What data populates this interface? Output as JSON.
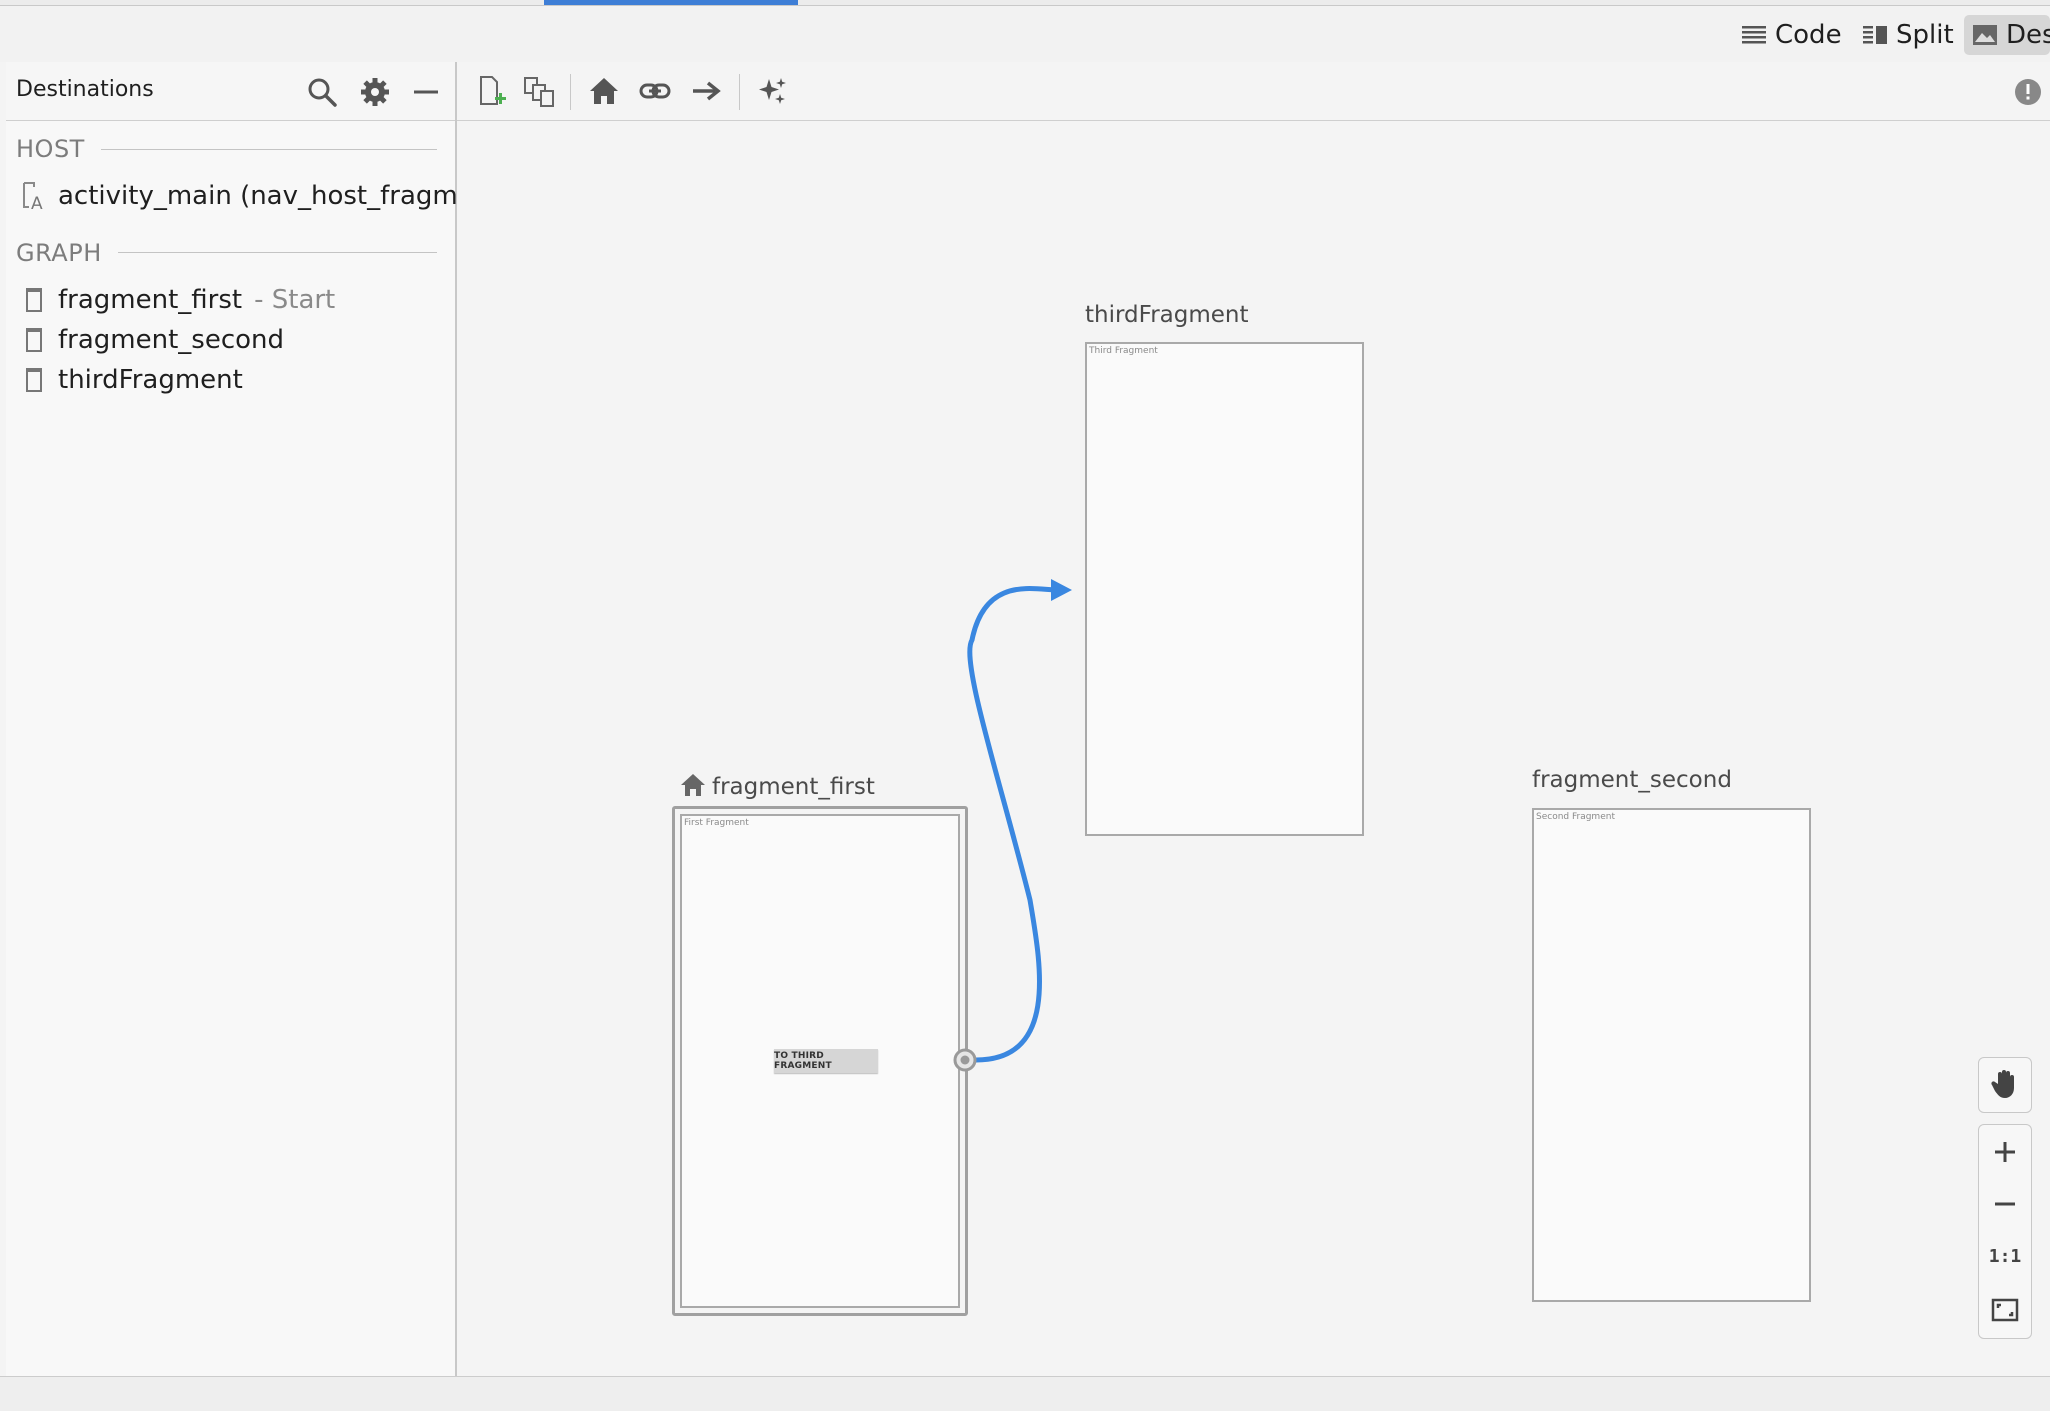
{
  "mode_bar": {
    "code_label": "Code",
    "split_label": "Split",
    "design_label": "Des"
  },
  "destinations_panel": {
    "title": "Destinations",
    "host_section": {
      "title": "HOST",
      "items": [
        {
          "label": "activity_main (nav_host_fragmen",
          "icon": "layout-activity-icon"
        }
      ]
    },
    "graph_section": {
      "title": "GRAPH",
      "items": [
        {
          "label": "fragment_first",
          "suffix": "- Start",
          "icon": "fragment-icon"
        },
        {
          "label": "fragment_second",
          "suffix": "",
          "icon": "fragment-icon"
        },
        {
          "label": "thirdFragment",
          "suffix": "",
          "icon": "fragment-icon"
        }
      ]
    }
  },
  "toolbar_icons": [
    "new-destination-icon",
    "nested-graph-icon",
    "assign-start-icon",
    "deep-link-icon",
    "add-action-icon",
    "auto-arrange-icon"
  ],
  "graph": {
    "fragments": {
      "first": {
        "name": "fragment_first",
        "preview_title": "First Fragment",
        "button_label": "TO THIRD FRAGMENT",
        "is_start": true
      },
      "second": {
        "name": "fragment_second",
        "preview_title": "Second Fragment"
      },
      "third": {
        "name": "thirdFragment",
        "preview_title": "Third Fragment"
      }
    },
    "actions": [
      {
        "from": "fragment_first",
        "to": "thirdFragment"
      }
    ]
  },
  "zoom_controls": {
    "pan_icon": "hand-icon",
    "zoom_in_icon": "plus-icon",
    "zoom_out_icon": "minus-icon",
    "actual_size_label": "1:1",
    "fit_icon": "fit-screen-icon"
  },
  "colors": {
    "accent": "#3e7ed6",
    "action_arrow": "#3a87e0",
    "add_green": "#4caf50"
  }
}
